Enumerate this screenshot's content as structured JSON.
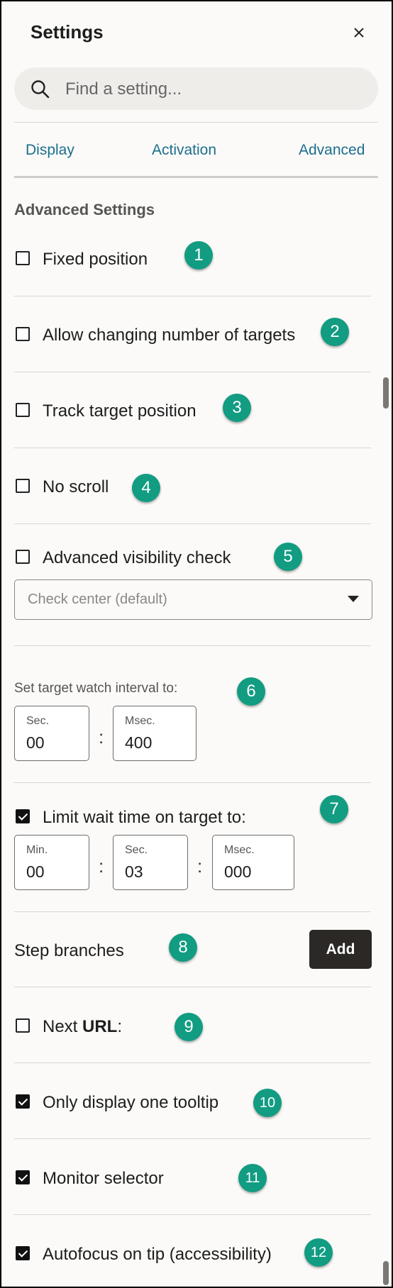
{
  "panel": {
    "title": "Settings",
    "search_placeholder": "Find a setting..."
  },
  "tabs": [
    {
      "label": "Display"
    },
    {
      "label": "Activation"
    },
    {
      "label": "Advanced"
    }
  ],
  "advanced": {
    "section_title": "Advanced Settings",
    "fixed_position": {
      "label": "Fixed position",
      "checked": false,
      "badge": "1"
    },
    "allow_changing_targets": {
      "label": "Allow changing number of targets",
      "checked": false,
      "badge": "2"
    },
    "track_target_position": {
      "label": "Track target position",
      "checked": false,
      "badge": "3"
    },
    "no_scroll": {
      "label": "No scroll",
      "checked": false,
      "badge": "4"
    },
    "advanced_visibility": {
      "label": "Advanced visibility check",
      "checked": false,
      "badge": "5",
      "select_value": "Check center (default)"
    },
    "watch_interval": {
      "label": "Set target watch interval to:",
      "badge": "6",
      "sec_label": "Sec.",
      "sec_value": "00",
      "msec_label": "Msec.",
      "msec_value": "400",
      "separator": ":"
    },
    "limit_wait": {
      "label": "Limit wait time on target to:",
      "checked": true,
      "badge": "7",
      "min_label": "Min.",
      "min_value": "00",
      "sec_label": "Sec.",
      "sec_value": "03",
      "msec_label": "Msec.",
      "msec_value": "000",
      "separator": ":"
    },
    "step_branches": {
      "label": "Step branches",
      "badge": "8",
      "button": "Add"
    },
    "next_url": {
      "label_prefix": "Next ",
      "label_bold": "URL",
      "label_suffix": ":",
      "checked": false,
      "badge": "9"
    },
    "one_tooltip": {
      "label": "Only display one tooltip",
      "checked": true,
      "badge": "10"
    },
    "monitor_selector": {
      "label": "Monitor selector",
      "checked": true,
      "badge": "11"
    },
    "autofocus": {
      "label": "Autofocus on tip (accessibility)",
      "checked": true,
      "badge": "12"
    }
  },
  "colors": {
    "accent_tab": "#1c6e8d",
    "badge": "#129c82",
    "add_button": "#2b2825",
    "panel_bg": "#fbfaf8"
  }
}
